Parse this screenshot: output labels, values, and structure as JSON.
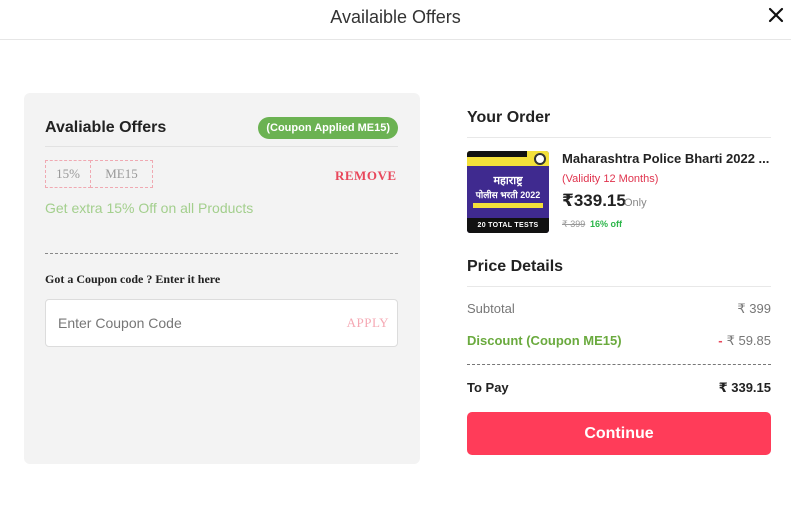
{
  "header": {
    "title": "Availaible Offers"
  },
  "offers": {
    "heading": "Avaliable Offers",
    "badge": "(Coupon Applied ME15)",
    "coupon_percent": "15%",
    "coupon_code": "ME15",
    "remove_label": "REMOVE",
    "note": "Get extra 15% Off on all Products",
    "prompt": "Got a Coupon code ? Enter it here",
    "input_placeholder": "Enter Coupon Code",
    "input_value": "",
    "apply_label": "APPLY"
  },
  "order": {
    "title": "Your Order",
    "product": {
      "name": "Maharashtra Police Bharti 2022 ...",
      "validity": "(Validity 12 Months)",
      "price": "₹339.15",
      "price_suffix": "Only",
      "original_price": "₹ 399",
      "discount_label": "16% off",
      "thumb_text_1": "महाराष्ट्र",
      "thumb_text_2": "पोलीस भरती 2022",
      "thumb_footer": "20 TOTAL TESTS"
    }
  },
  "price_details": {
    "title": "Price Details",
    "subtotal_label": "Subtotal",
    "subtotal_value": "₹ 399",
    "discount_label": "Discount (Coupon ME15)",
    "discount_sign": "-",
    "discount_value": "₹ 59.85",
    "to_pay_label": "To Pay",
    "to_pay_value": "₹ 339.15"
  },
  "actions": {
    "continue_label": "Continue"
  },
  "colors": {
    "accent": "#ff3c59",
    "badge_green": "#6bb252",
    "remove_red": "#e8475b",
    "panel_bg": "#f3f3f3"
  },
  "icons": {
    "close": "close-icon"
  }
}
